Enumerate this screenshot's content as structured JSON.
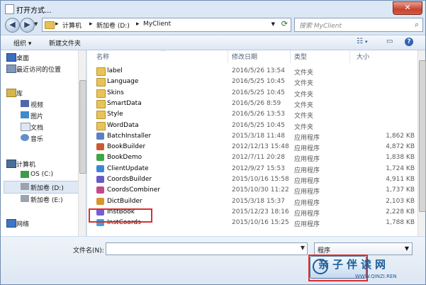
{
  "window": {
    "title": "打开方式..."
  },
  "address": {
    "crumbs": [
      "计算机",
      "新加卷 (D:)",
      "MyClient"
    ],
    "search_placeholder": "搜索 MyClient"
  },
  "toolbar": {
    "organize": "组织 ▾",
    "new_folder": "新建文件夹"
  },
  "sidebar": {
    "items": [
      {
        "label": "桌面",
        "icon": "desktop-icon"
      },
      {
        "label": "最近访问的位置",
        "icon": "recent-places-icon"
      },
      {
        "label": "库",
        "icon": "library-icon"
      },
      {
        "label": "视频",
        "icon": "video-icon"
      },
      {
        "label": "图片",
        "icon": "pictures-icon"
      },
      {
        "label": "文档",
        "icon": "documents-icon"
      },
      {
        "label": "音乐",
        "icon": "music-icon"
      },
      {
        "label": "计算机",
        "icon": "computer-icon"
      },
      {
        "label": "OS (C:)",
        "icon": "drive-icon"
      },
      {
        "label": "新加卷 (D:)",
        "icon": "drive-icon"
      },
      {
        "label": "新加卷 (E:)",
        "icon": "drive-icon"
      },
      {
        "label": "网络",
        "icon": "network-icon"
      }
    ]
  },
  "columns": {
    "name": "名称",
    "date": "修改日期",
    "type": "类型",
    "size": "大小"
  },
  "files": [
    {
      "name": "label",
      "date": "2016/5/26 13:54",
      "type": "文件夹",
      "size": "",
      "kind": "folder"
    },
    {
      "name": "Language",
      "date": "2016/5/25 10:45",
      "type": "文件夹",
      "size": "",
      "kind": "folder"
    },
    {
      "name": "Skins",
      "date": "2016/5/25 10:45",
      "type": "文件夹",
      "size": "",
      "kind": "folder"
    },
    {
      "name": "SmartData",
      "date": "2016/5/26 8:59",
      "type": "文件夹",
      "size": "",
      "kind": "folder"
    },
    {
      "name": "Style",
      "date": "2016/5/26 13:53",
      "type": "文件夹",
      "size": "",
      "kind": "folder"
    },
    {
      "name": "WordData",
      "date": "2016/5/25 10:45",
      "type": "文件夹",
      "size": "",
      "kind": "folder"
    },
    {
      "name": "BatchInstaller",
      "date": "2015/3/18 11:48",
      "type": "应用程序",
      "size": "1,862 KB",
      "kind": "app",
      "color": "#5b7fc4"
    },
    {
      "name": "BookBuilder",
      "date": "2012/12/13 15:48",
      "type": "应用程序",
      "size": "4,872 KB",
      "kind": "app",
      "color": "#c85a34"
    },
    {
      "name": "BookDemo",
      "date": "2012/7/11 20:28",
      "type": "应用程序",
      "size": "1,838 KB",
      "kind": "app",
      "color": "#3ba845"
    },
    {
      "name": "ClientUpdate",
      "date": "2012/9/27 15:53",
      "type": "应用程序",
      "size": "1,724 KB",
      "kind": "app",
      "color": "#3d86d6"
    },
    {
      "name": "CoordsBuilder",
      "date": "2015/10/16 15:58",
      "type": "应用程序",
      "size": "4,911 KB",
      "kind": "app",
      "color": "#6b59c8"
    },
    {
      "name": "CoordsCombiner",
      "date": "2015/10/30 11:22",
      "type": "应用程序",
      "size": "1,737 KB",
      "kind": "app",
      "color": "#c24a8c"
    },
    {
      "name": "DictBuilder",
      "date": "2015/3/18 15:37",
      "type": "应用程序",
      "size": "2,103 KB",
      "kind": "app",
      "color": "#d8962c"
    },
    {
      "name": "InstBook",
      "date": "2015/12/23 18:16",
      "type": "应用程序",
      "size": "2,228 KB",
      "kind": "app",
      "color": "#7a5bd1"
    },
    {
      "name": "InstCoords",
      "date": "2015/10/16 15:25",
      "type": "应用程序",
      "size": "1,788 KB",
      "kind": "app",
      "color": "#4a9bd8"
    }
  ],
  "bottom": {
    "filename_label": "文件名(N):",
    "filetype": "程序"
  },
  "watermark": {
    "text": "亲子伴读网",
    "url": "WWW.QINZI.REN"
  }
}
